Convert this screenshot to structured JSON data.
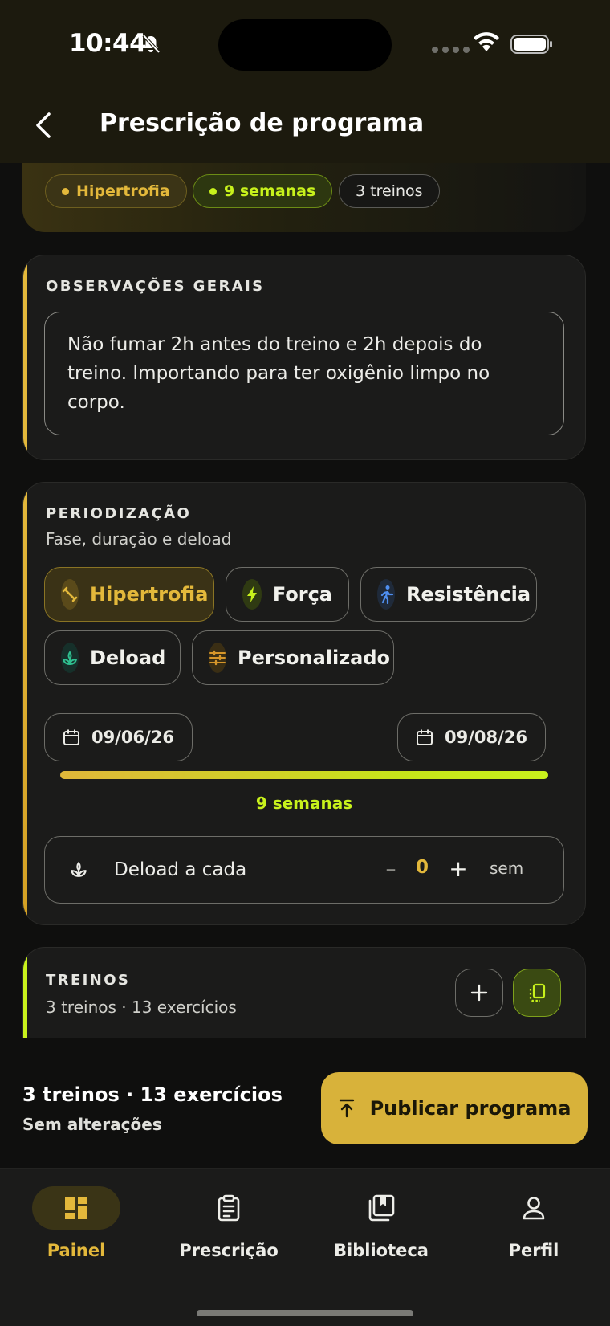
{
  "status_bar": {
    "time": "10:44"
  },
  "header": {
    "title": "Prescrição de programa"
  },
  "summary": {
    "phase_pill": "Hipertrofia",
    "weeks_pill": "9 semanas",
    "workouts_pill": "3 treinos"
  },
  "observations": {
    "label": "OBSERVAÇÕES GERAIS",
    "text": "Não fumar 2h antes do treino e 2h depois do treino. Importando para ter oxigênio limpo no corpo."
  },
  "periodization": {
    "label": "PERIODIZAÇÃO",
    "subtitle": "Fase, duração e deload",
    "phases": [
      {
        "label": "Hipertrofia",
        "icon": "dumbbell-icon",
        "active": true
      },
      {
        "label": "Força",
        "icon": "bolt-icon",
        "active": false
      },
      {
        "label": "Resistência",
        "icon": "runner-icon",
        "active": false
      },
      {
        "label": "Deload",
        "icon": "sprout-icon",
        "active": false
      },
      {
        "label": "Personalizado",
        "icon": "sliders-icon",
        "active": false
      }
    ],
    "start_date": "09/06/26",
    "end_date": "09/08/26",
    "duration_label": "9 semanas",
    "deload": {
      "label": "Deload a cada",
      "minus": "–",
      "value": "0",
      "plus": "+",
      "unit": "sem"
    }
  },
  "workouts": {
    "label": "TREINOS",
    "subtitle": "3 treinos · 13 exercícios"
  },
  "action_bar": {
    "count": "3 treinos · 13 exercícios",
    "status": "Sem alterações",
    "publish_label": "Publicar programa"
  },
  "tabs": [
    {
      "label": "Painel",
      "icon": "dashboard-icon",
      "active": true
    },
    {
      "label": "Prescrição",
      "icon": "clipboard-icon",
      "active": false
    },
    {
      "label": "Biblioteca",
      "icon": "library-icon",
      "active": false
    },
    {
      "label": "Perfil",
      "icon": "user-icon",
      "active": false
    }
  ],
  "colors": {
    "accent_gold": "#e3b83b",
    "accent_lime": "#c8f21c",
    "background": "#0f0f0e",
    "card": "#1b1b1a"
  }
}
